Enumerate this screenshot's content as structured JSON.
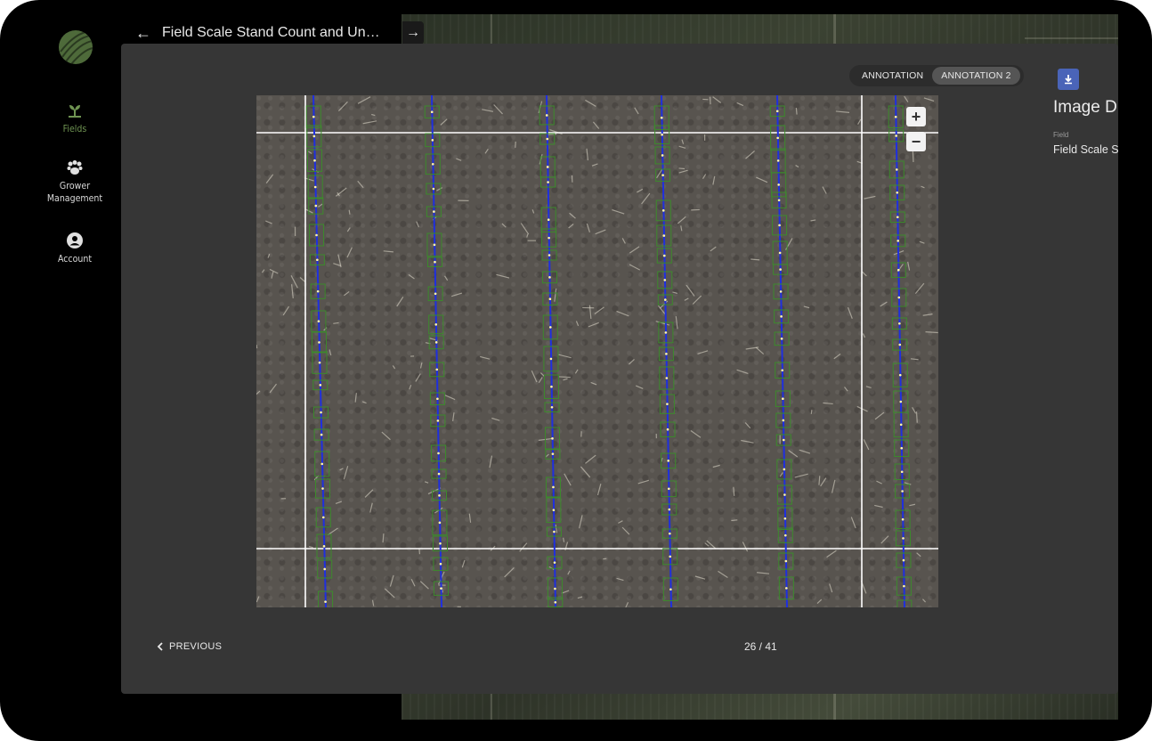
{
  "nav": {
    "items": [
      {
        "label": "Fields",
        "icon": "sprout-icon",
        "active": true
      },
      {
        "label": "Grower\nManagement",
        "icon": "group-icon",
        "active": false
      },
      {
        "label": "Account",
        "icon": "account-icon",
        "active": false
      }
    ]
  },
  "header": {
    "back_icon": "arrow-left-icon",
    "title": "Field Scale Stand Count and Un…",
    "next_icon": "arrow-right-icon"
  },
  "toggle": {
    "options": [
      "ANNOTATION",
      "ANNOTATION 2"
    ],
    "selected": "ANNOTATION 2"
  },
  "details": {
    "download_icon": "download-icon",
    "title": "Image D",
    "field_label": "Field",
    "field_value": "Field Scale S"
  },
  "viewer": {
    "zoom_in": "+",
    "zoom_out": "−"
  },
  "pager": {
    "previous_label": "PREVIOUS",
    "counter": "26 / 41"
  },
  "colors": {
    "accent_green": "#6f9452",
    "row_line": "#1f2fe0",
    "box": "#3c8a2c",
    "download_bg": "#4a64b8"
  }
}
